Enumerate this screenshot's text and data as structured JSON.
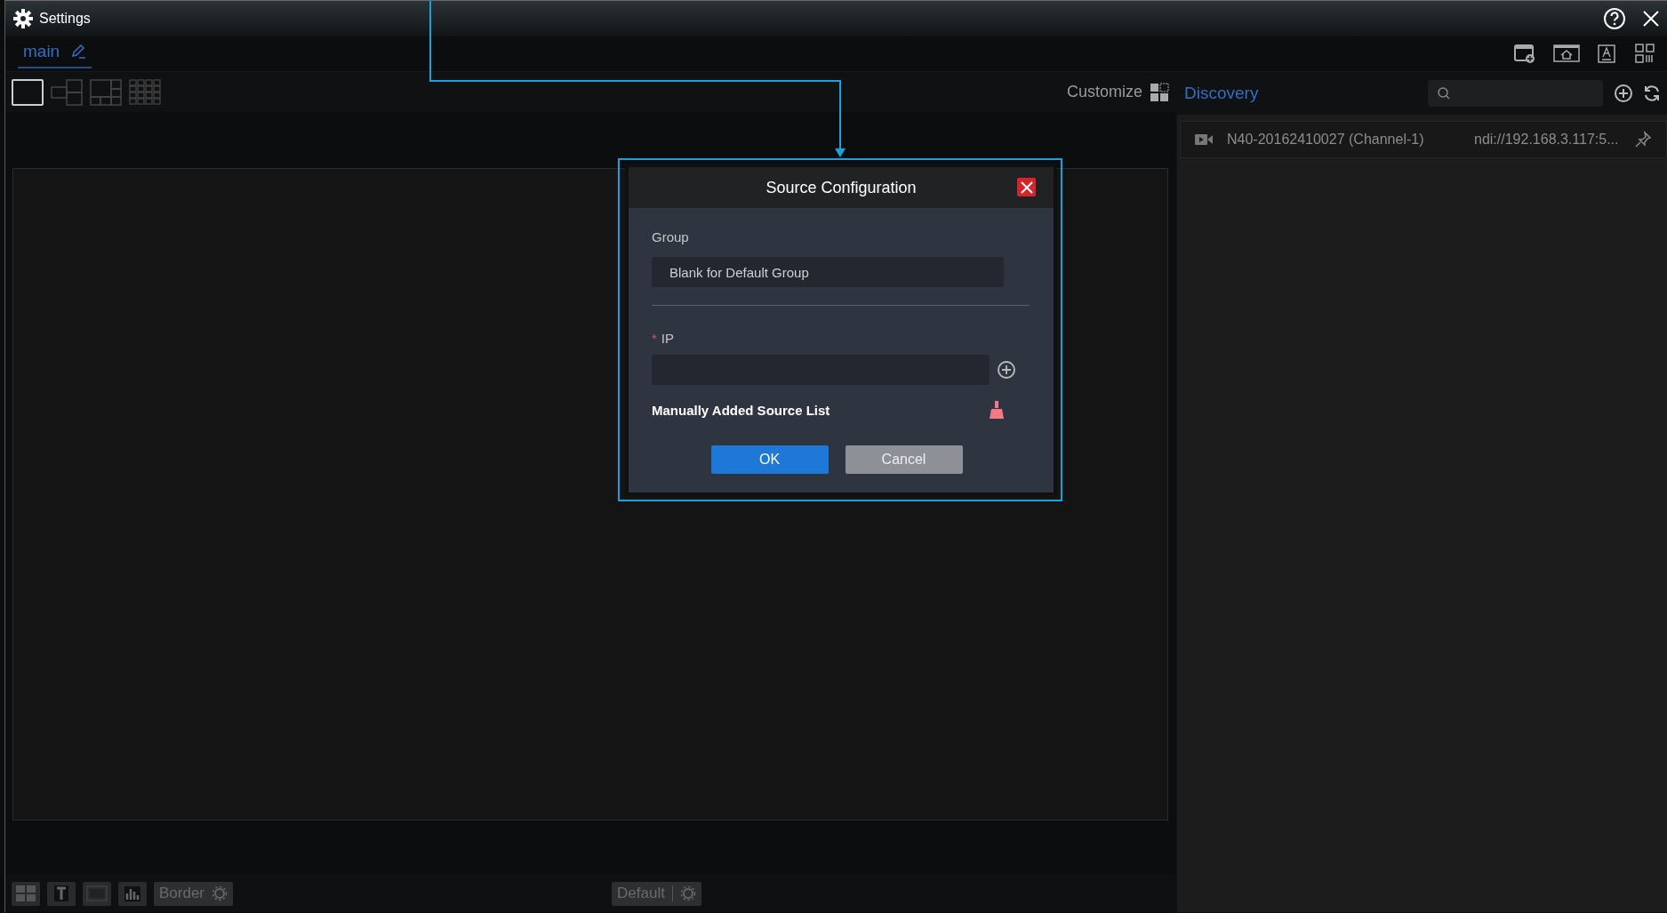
{
  "window": {
    "title": "Settings"
  },
  "tabs": [
    {
      "label": "main",
      "selected": true
    }
  ],
  "layouts": [
    {
      "kind": "single",
      "selected": true
    },
    {
      "kind": "split",
      "selected": false
    },
    {
      "kind": "mosaic",
      "selected": false
    },
    {
      "kind": "grid",
      "selected": false
    }
  ],
  "customize": "Customize",
  "discovery": {
    "title": "Discovery",
    "sources": [
      {
        "name": "N40-20162410027 (Channel-1)",
        "address": "ndi://192.168.3.117:5..."
      }
    ]
  },
  "dialog": {
    "title": "Source Configuration",
    "group_label": "Group",
    "group_placeholder": "Blank for Default Group",
    "required_mark": "*",
    "ip_label": "IP",
    "list_title": "Manually Added Source List",
    "buttons": [
      {
        "label": "OK",
        "kind": "primary"
      },
      {
        "label": "Cancel",
        "kind": "secondary"
      }
    ]
  },
  "bottom_bar": {
    "border_label": "Border",
    "preset_label": "Default"
  }
}
